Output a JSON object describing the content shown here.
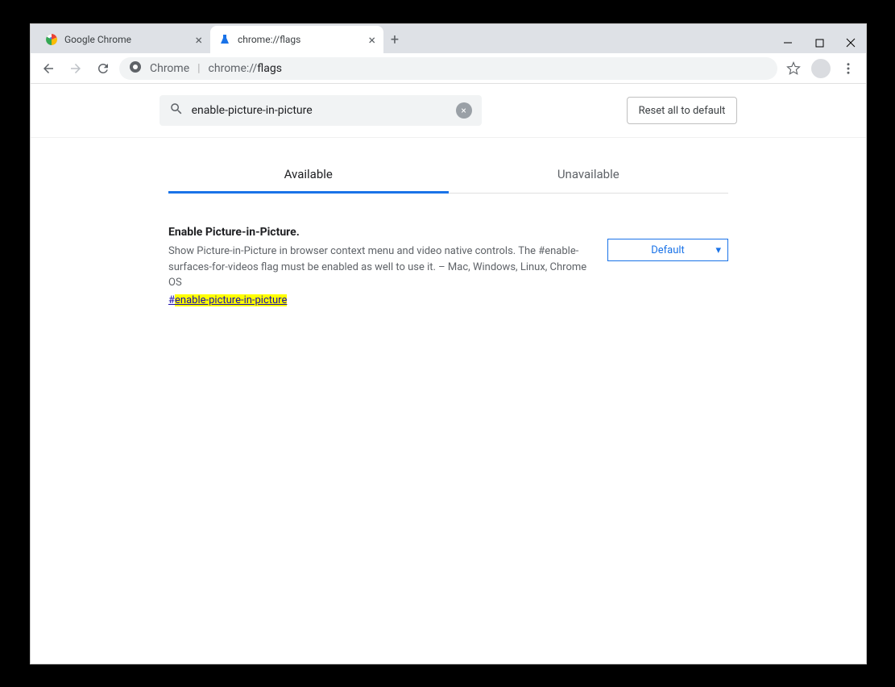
{
  "window": {
    "tabs": [
      {
        "title": "Google Chrome",
        "active": false
      },
      {
        "title": "chrome://flags",
        "active": true
      }
    ]
  },
  "omnibox": {
    "prefix": "Chrome",
    "url": "chrome://",
    "path": "flags"
  },
  "flags": {
    "search": {
      "value": "enable-picture-in-picture"
    },
    "reset_label": "Reset all to default",
    "tabs": {
      "available": "Available",
      "unavailable": "Unavailable"
    },
    "item": {
      "title": "Enable Picture-in-Picture.",
      "description": "Show Picture-in-Picture in browser context menu and video native controls. The #enable-surfaces-for-videos flag must be enabled as well to use it. – Mac, Windows, Linux, Chrome OS",
      "link_prefix": "#",
      "link_text": "enable-picture-in-picture",
      "select_value": "Default"
    }
  }
}
